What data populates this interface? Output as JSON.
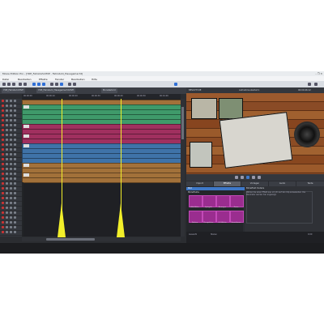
{
  "window": {
    "title": "Movie Edition Pro - [YDE_Fahrstuhl.MVP - Fahrstuhl_Hausgemacht]",
    "controls": "–  ❐  ✕"
  },
  "menu": {
    "items": [
      "Datei",
      "Bearbeiten",
      "Effekte",
      "Fenster",
      "Bearbeiten",
      "Hilfe"
    ]
  },
  "tabs": {
    "items": [
      "YDE_Fahrstuhl.MVP",
      "YDE_Fahrstuhl_Hausgemacht.MVP",
      "Monsterbird"
    ]
  },
  "ruler": {
    "labels": [
      "00:00:00",
      "00:00:10",
      "00:00:20",
      "00:00:30",
      "00:00:40",
      "00:00:50",
      "00:01:00"
    ]
  },
  "preview": {
    "header_left": "BESICHT.DE",
    "header_mid": "Aufnahme startet ▾",
    "header_right": "00:00:46:12"
  },
  "effects_tabs": [
    "Import",
    "Effekte",
    "Vorlagen",
    "Audio",
    "Texte"
  ],
  "effects_panel": {
    "category_selected": "Bild",
    "category_header": "Bildeffekte",
    "tiles": [
      "Bild Effekt",
      "Spiegeln",
      "Bewegen",
      "Zoom",
      "Drehen",
      "Perspektive",
      "Gl. Effekte",
      "Korrekturen"
    ],
    "detail_header": "Bildeffekt Details",
    "detail_text": "Wählen Sie einen Effekt aus, um ihn auf den Clip anzuwenden. Die Parameter werden hier angezeigt."
  },
  "status": {
    "left": "Auswahl",
    "mid": "Stereo",
    "right": "0:00"
  },
  "colors": {
    "green_track": "#3f9a6a",
    "magenta_track": "#a0305f",
    "blue_track": "#3f73a8",
    "brown_track": "#a2713a",
    "marker": "#f2ef2a"
  }
}
